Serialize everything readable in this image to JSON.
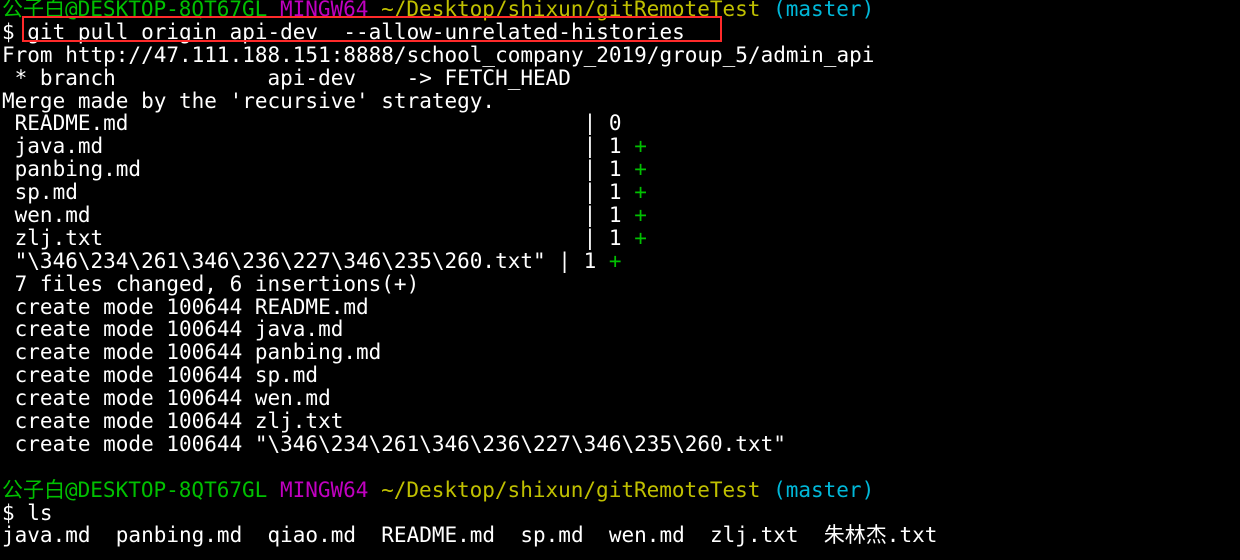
{
  "prompt1": {
    "user": "公子白@DESKTOP-8QT67GL",
    "env": "MINGW64",
    "path": "~/Desktop/shixun/gitRemoteTest",
    "branch": "(master)"
  },
  "command1": "$ git pull origin api-dev  --allow-unrelated-histories",
  "output1": [
    "From http://47.111.188.151:8888/school_company_2019/group_5/admin_api",
    " * branch            api-dev    -> FETCH_HEAD",
    "Merge made by the 'recursive' strategy."
  ],
  "diffstat": [
    {
      "file": " README.md                                    ",
      "count": "| 0",
      "plus": ""
    },
    {
      "file": " java.md                                      ",
      "count": "| 1",
      "plus": "+"
    },
    {
      "file": " panbing.md                                   ",
      "count": "| 1",
      "plus": "+"
    },
    {
      "file": " sp.md                                        ",
      "count": "| 1",
      "plus": "+"
    },
    {
      "file": " wen.md                                       ",
      "count": "| 1",
      "plus": "+"
    },
    {
      "file": " zlj.txt                                      ",
      "count": "| 1",
      "plus": "+"
    },
    {
      "file": " \"\\346\\234\\261\\346\\236\\227\\346\\235\\260.txt\" ",
      "count": "| 1",
      "plus": "+"
    }
  ],
  "summary": " 7 files changed, 6 insertions(+)",
  "create_modes": [
    " create mode 100644 README.md",
    " create mode 100644 java.md",
    " create mode 100644 panbing.md",
    " create mode 100644 sp.md",
    " create mode 100644 wen.md",
    " create mode 100644 zlj.txt",
    " create mode 100644 \"\\346\\234\\261\\346\\236\\227\\346\\235\\260.txt\""
  ],
  "prompt2": {
    "user": "公子白@DESKTOP-8QT67GL",
    "env": "MINGW64",
    "path": "~/Desktop/shixun/gitRemoteTest",
    "branch": "(master)"
  },
  "command2": "$ ls",
  "ls_output": "java.md  panbing.md  qiao.md  README.md  sp.md  wen.md  zlj.txt  朱林杰.txt",
  "colors": {
    "background": "#000000",
    "text": "#ffffff",
    "user": "#00c000",
    "mingw": "#c000c0",
    "path": "#c0c000",
    "branch": "#00b8d9",
    "highlight_box": "#ff2a2a"
  }
}
